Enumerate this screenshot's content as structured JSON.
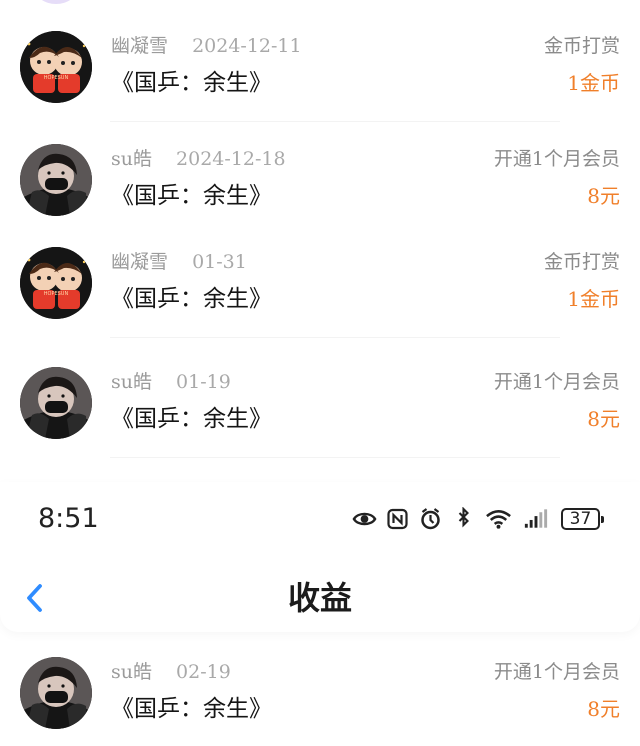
{
  "status_bar": {
    "time": "8:51",
    "battery": "37",
    "icons": [
      "eye-icon",
      "nfc-icon",
      "alarm-icon",
      "bluetooth-icon",
      "wifi-icon",
      "signal-icon",
      "battery-icon"
    ]
  },
  "header": {
    "title": "收益",
    "back_icon": "chevron-left-icon",
    "accent_color": "#2f8cff"
  },
  "colors": {
    "amount": "#f07f2a",
    "muted_text": "#9b9b9b",
    "primary_text": "#151515"
  },
  "records": [
    {
      "name": "幽凝雪",
      "date": "2024-12-11",
      "title": "《国乒：余生》",
      "action": "金币打赏",
      "amount": "1金币",
      "avatar": "cartoon-couple-avatar"
    },
    {
      "name": "su皓",
      "date": "2024-12-18",
      "title": "《国乒：余生》",
      "action": "开通1个月会员",
      "amount": "8元",
      "avatar": "masked-person-avatar"
    },
    {
      "name": "幽凝雪",
      "date": "01-31",
      "title": "《国乒：余生》",
      "action": "金币打赏",
      "amount": "1金币",
      "avatar": "cartoon-couple-avatar"
    },
    {
      "name": "su皓",
      "date": "01-19",
      "title": "《国乒：余生》",
      "action": "开通1个月会员",
      "amount": "8元",
      "avatar": "masked-person-avatar"
    },
    {
      "name": "su皓",
      "date": "02-19",
      "title": "《国乒：余生》",
      "action": "开通1个月会员",
      "amount": "8元",
      "avatar": "masked-person-avatar"
    }
  ]
}
